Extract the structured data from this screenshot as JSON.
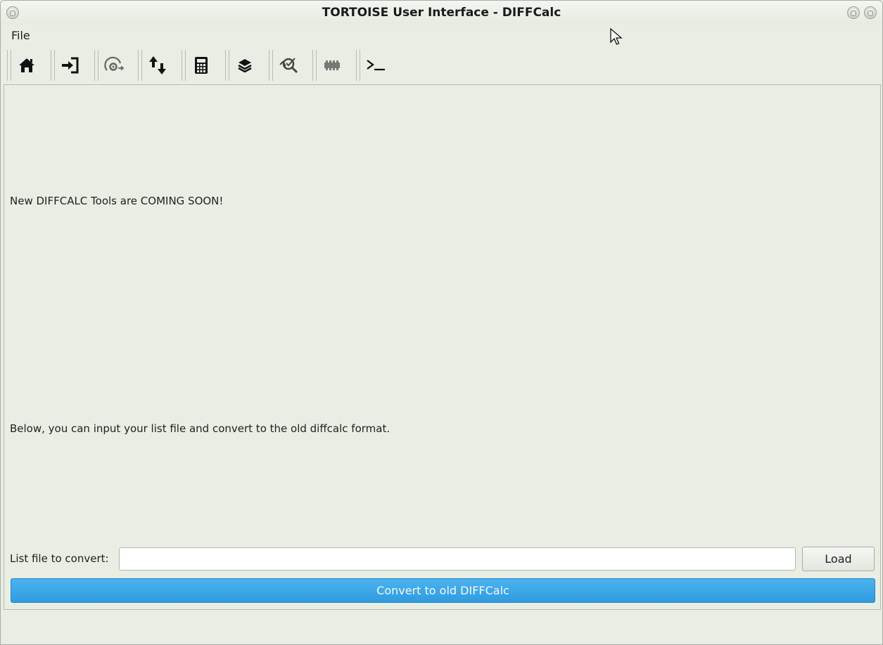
{
  "window": {
    "title": "TORTOISE User Interface - DIFFCalc"
  },
  "menubar": {
    "items": [
      {
        "label": "File"
      }
    ]
  },
  "toolbar": {
    "buttons": [
      {
        "icon": "home-icon"
      },
      {
        "icon": "import-icon"
      },
      {
        "icon": "speedometer-gear-icon"
      },
      {
        "icon": "up-down-arrows-icon"
      },
      {
        "icon": "calculator-icon"
      },
      {
        "icon": "layers-icon"
      },
      {
        "icon": "magnifier-check-icon"
      },
      {
        "icon": "film-strip-icon"
      },
      {
        "icon": "terminal-icon"
      }
    ]
  },
  "main": {
    "coming_soon_text": "New DIFFCALC Tools are COMING SOON!",
    "instruction_text": "Below, you can input your list file and convert to the old diffcalc format.",
    "file_label": "List file to convert:",
    "file_input_value": "",
    "load_label": "Load",
    "convert_label": "Convert to old DIFFCalc"
  },
  "colors": {
    "accent": "#3aa6e8",
    "background": "#e9eee5"
  }
}
